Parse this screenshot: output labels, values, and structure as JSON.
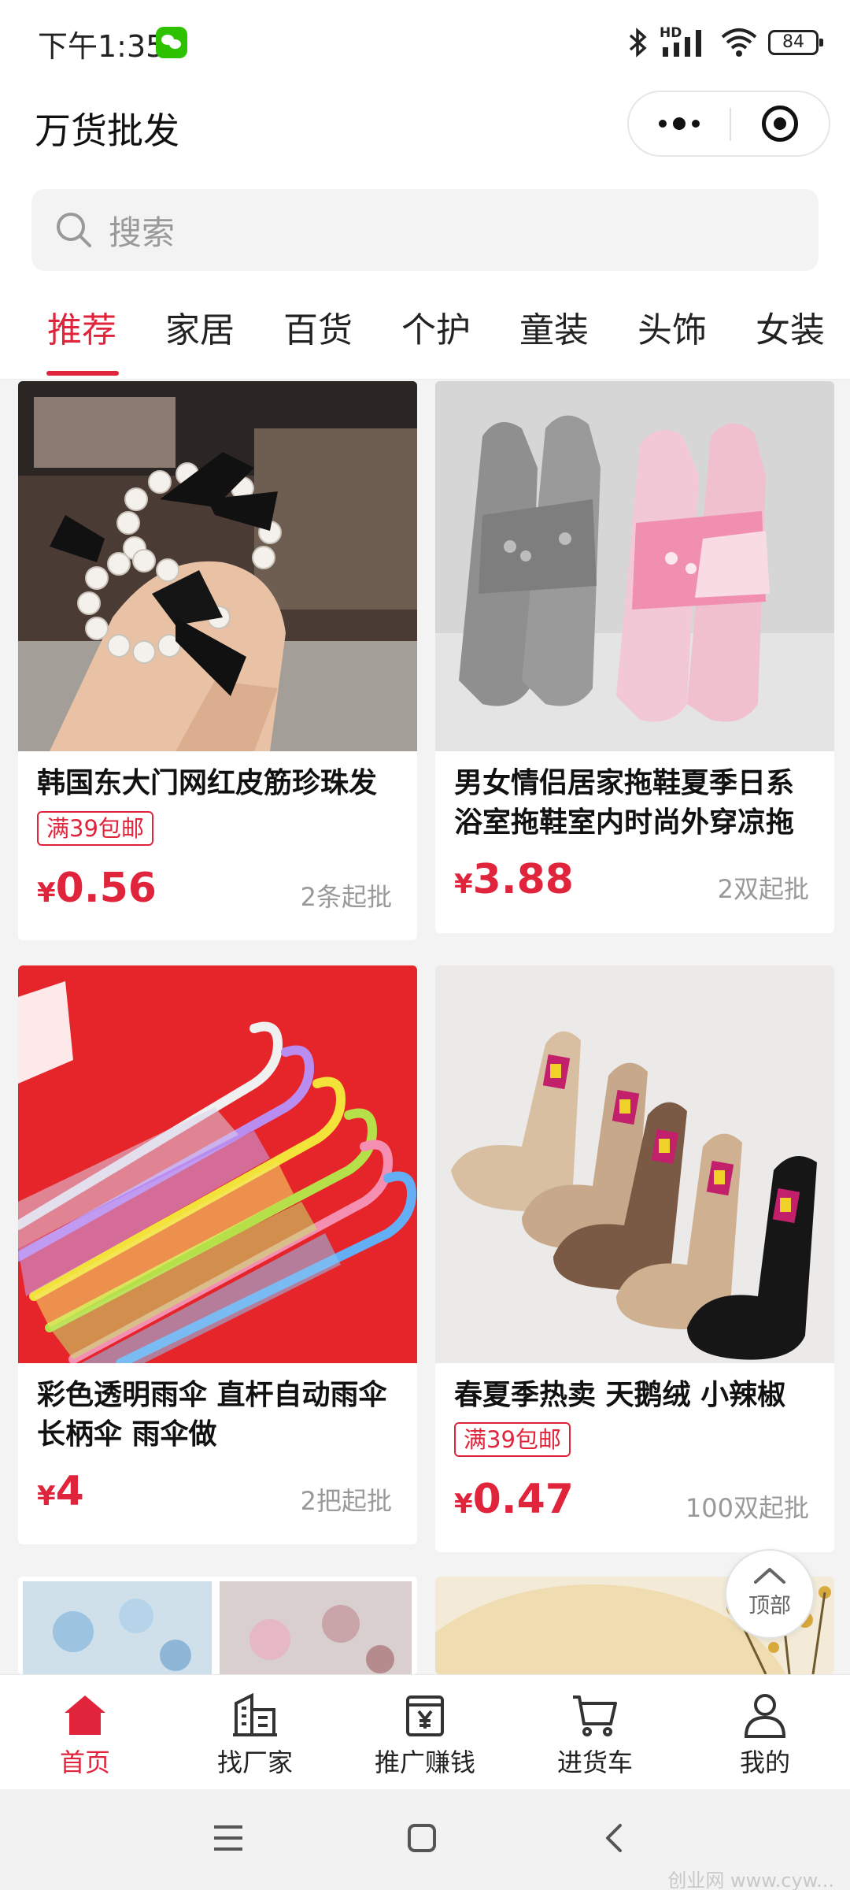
{
  "status_bar": {
    "time": "下午1:35",
    "battery": "84",
    "network_label": "HD"
  },
  "header": {
    "title": "万货批发"
  },
  "search": {
    "placeholder": "搜索"
  },
  "category_tabs": [
    {
      "label": "推荐",
      "active": true
    },
    {
      "label": "家居",
      "active": false
    },
    {
      "label": "百货",
      "active": false
    },
    {
      "label": "个护",
      "active": false
    },
    {
      "label": "童装",
      "active": false
    },
    {
      "label": "头饰",
      "active": false
    },
    {
      "label": "女装",
      "active": false
    }
  ],
  "products": [
    {
      "name": "韩国东大门网红皮筋珍珠发",
      "promo": "满39包邮",
      "currency": "¥",
      "price": "0.56",
      "moq": "2条起批",
      "image": "pearl-bow-hair-ties"
    },
    {
      "name": "男女情侣居家拖鞋夏季日系浴室拖鞋室内时尚外穿凉拖",
      "promo": "",
      "currency": "¥",
      "price": "3.88",
      "moq": "2双起批",
      "image": "couple-slippers"
    },
    {
      "name": "彩色透明雨伞 直杆自动雨伞 长柄伞 雨伞做",
      "promo": "",
      "currency": "¥",
      "price": "4",
      "moq": "2把起批",
      "image": "colorful-umbrellas"
    },
    {
      "name": "春夏季热卖 天鹅绒 小辣椒",
      "promo": "满39包邮",
      "currency": "¥",
      "price": "0.47",
      "moq": "100双起批",
      "image": "velvet-socks"
    }
  ],
  "back_to_top": {
    "label": "顶部"
  },
  "bottom_nav": [
    {
      "label": "首页",
      "icon": "home-icon",
      "active": true
    },
    {
      "label": "找厂家",
      "icon": "factory-icon",
      "active": false
    },
    {
      "label": "推广赚钱",
      "icon": "earn-money-icon",
      "active": false
    },
    {
      "label": "进货车",
      "icon": "cart-icon",
      "active": false
    },
    {
      "label": "我的",
      "icon": "user-icon",
      "active": false
    }
  ],
  "watermark": "创业网 www.cyw...",
  "colors": {
    "accent": "#e0243c",
    "background": "#f3f3f3"
  }
}
